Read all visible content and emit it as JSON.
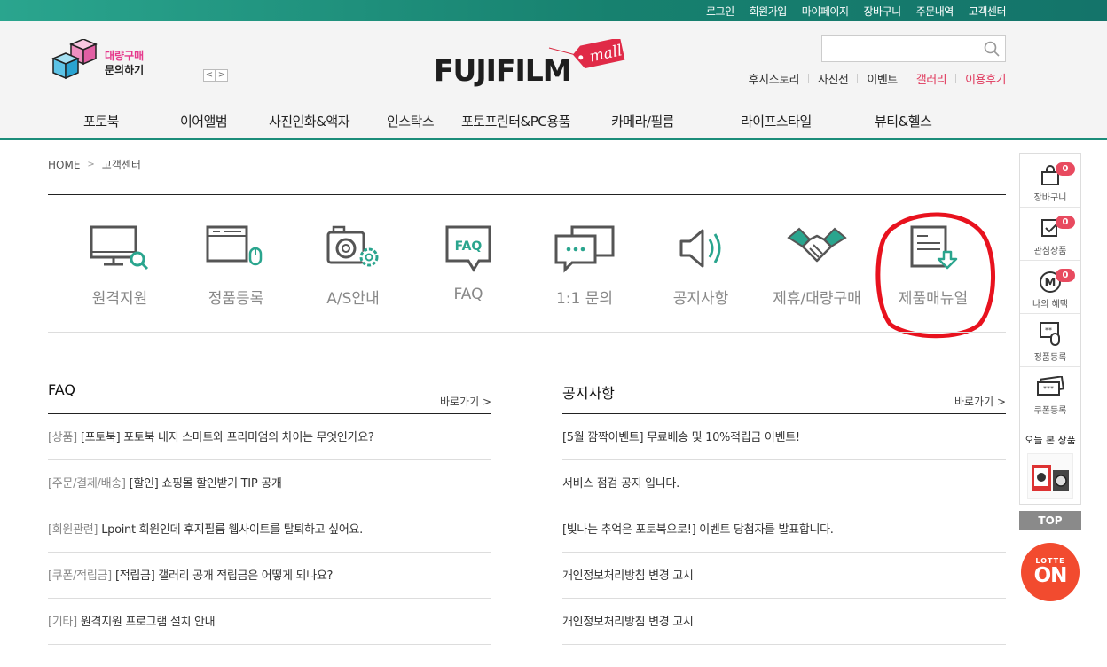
{
  "topbar": {
    "links": [
      "로그인",
      "회원가입",
      "마이페이지",
      "장바구니",
      "주문내역",
      "고객센터"
    ]
  },
  "header": {
    "bulk": {
      "line1": "대량구매",
      "line2": "문의하기"
    },
    "arrows": {
      "prev": "<",
      "next": ">"
    },
    "logo": {
      "word": "FUJIFILM",
      "tag": "mall"
    },
    "search": {
      "value": "",
      "placeholder": ""
    },
    "sublinks": [
      "후지스토리",
      "사진전",
      "이벤트",
      "갤러리",
      "이용후기"
    ],
    "gnb": [
      "포토북",
      "이어앨범",
      "사진인화&액자",
      "인스탁스",
      "포토프린터&PC용품",
      "카메라/필름",
      "라이프스타일",
      "뷰티&헬스"
    ]
  },
  "breadcrumb": {
    "home": "HOME",
    "sep": ">",
    "current": "고객센터"
  },
  "services": [
    "원격지원",
    "정품등록",
    "A/S안내",
    "FAQ",
    "1:1 문의",
    "공지사항",
    "제휴/대량구매",
    "제품매뉴얼"
  ],
  "faq": {
    "title": "FAQ",
    "more": "바로가기 >",
    "rows": [
      {
        "cat": "[상품]",
        "text": "[포토북] 포토북 내지 스마트와 프리미엄의 차이는 무엇인가요?"
      },
      {
        "cat": "[주문/결제/배송]",
        "text": "[할인] 쇼핑몰 할인받기 TIP 공개"
      },
      {
        "cat": "[회원관련]",
        "text": "Lpoint 회원인데 후지필름 웹사이트를 탈퇴하고 싶어요."
      },
      {
        "cat": "[쿠폰/적립금]",
        "text": "[적립금] 갤러리 공개 적립금은 어떻게 되나요?"
      },
      {
        "cat": "[기타]",
        "text": "원격지원 프로그램 설치 안내"
      }
    ]
  },
  "notice": {
    "title": "공지사항",
    "more": "바로가기 >",
    "rows": [
      "[5월 깜짝이벤트] 무료배송 및 10%적립금 이벤트!",
      "서비스 점검 공지 입니다.",
      "[빛나는 추억은 포토북으로!] 이벤트 당첨자를 발표합니다.",
      "개인정보처리방침 변경 고시",
      "개인정보처리방침 변경 고시"
    ]
  },
  "quick": {
    "items": [
      {
        "label": "장바구니",
        "badge": "0"
      },
      {
        "label": "관심상품",
        "badge": "0"
      },
      {
        "label": "나의 혜택",
        "badge": "0"
      },
      {
        "label": "정품등록"
      },
      {
        "label": "쿠폰등록"
      }
    ],
    "recent": "오늘 본 상품",
    "top": "TOP",
    "lotte_small": "LOTTE",
    "lotte_big": "ON"
  },
  "colors": {
    "accent": "#1c8d7a",
    "pink": "#e6388c",
    "annotation": "#e8121e",
    "badge": "#e84a5f"
  }
}
